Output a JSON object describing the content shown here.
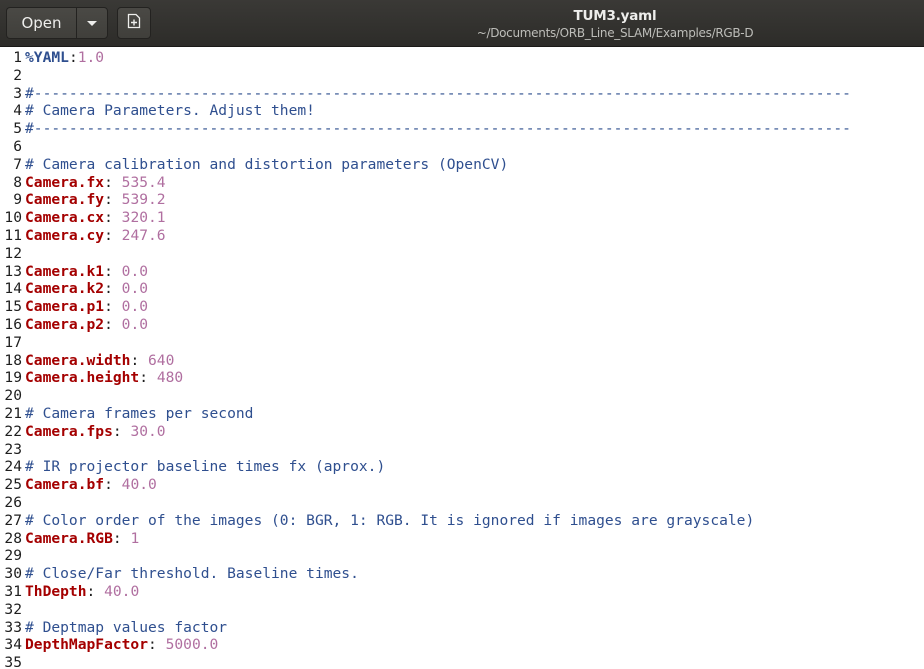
{
  "header": {
    "open_label": "Open",
    "title": "TUM3.yaml",
    "path": "~/Documents/ORB_Line_SLAM/Examples/RGB-D"
  },
  "icons": {
    "open_menu": "chevron-down-icon",
    "new_tab": "new-document-icon"
  },
  "colors": {
    "comment": "#2f4f8f",
    "key": "#a40000",
    "value": "#b06fa0",
    "header_bg": "#2d2c29"
  },
  "editor": {
    "lines": [
      {
        "num": "1",
        "type": "directive",
        "directive": "%YAML",
        "sep": ":",
        "value": "1.0"
      },
      {
        "num": "2",
        "type": "blank"
      },
      {
        "num": "3",
        "type": "comment",
        "text": "#---------------------------------------------------------------------------------------------"
      },
      {
        "num": "4",
        "type": "comment",
        "text": "# Camera Parameters. Adjust them!"
      },
      {
        "num": "5",
        "type": "comment",
        "text": "#---------------------------------------------------------------------------------------------"
      },
      {
        "num": "6",
        "type": "blank"
      },
      {
        "num": "7",
        "type": "comment",
        "text": "# Camera calibration and distortion parameters (OpenCV)"
      },
      {
        "num": "8",
        "type": "kv",
        "key": "Camera.fx",
        "value": "535.4"
      },
      {
        "num": "9",
        "type": "kv",
        "key": "Camera.fy",
        "value": "539.2"
      },
      {
        "num": "10",
        "type": "kv",
        "key": "Camera.cx",
        "value": "320.1"
      },
      {
        "num": "11",
        "type": "kv",
        "key": "Camera.cy",
        "value": "247.6"
      },
      {
        "num": "12",
        "type": "blank"
      },
      {
        "num": "13",
        "type": "kv",
        "key": "Camera.k1",
        "value": "0.0"
      },
      {
        "num": "14",
        "type": "kv",
        "key": "Camera.k2",
        "value": "0.0"
      },
      {
        "num": "15",
        "type": "kv",
        "key": "Camera.p1",
        "value": "0.0"
      },
      {
        "num": "16",
        "type": "kv",
        "key": "Camera.p2",
        "value": "0.0"
      },
      {
        "num": "17",
        "type": "blank"
      },
      {
        "num": "18",
        "type": "kv",
        "key": "Camera.width",
        "value": "640"
      },
      {
        "num": "19",
        "type": "kv",
        "key": "Camera.height",
        "value": "480"
      },
      {
        "num": "20",
        "type": "blank"
      },
      {
        "num": "21",
        "type": "comment",
        "text": "# Camera frames per second"
      },
      {
        "num": "22",
        "type": "kv",
        "key": "Camera.fps",
        "value": "30.0"
      },
      {
        "num": "23",
        "type": "blank"
      },
      {
        "num": "24",
        "type": "comment",
        "text": "# IR projector baseline times fx (aprox.)"
      },
      {
        "num": "25",
        "type": "kv",
        "key": "Camera.bf",
        "value": "40.0"
      },
      {
        "num": "26",
        "type": "blank"
      },
      {
        "num": "27",
        "type": "comment",
        "text": "# Color order of the images (0: BGR, 1: RGB. It is ignored if images are grayscale)"
      },
      {
        "num": "28",
        "type": "kv",
        "key": "Camera.RGB",
        "value": "1"
      },
      {
        "num": "29",
        "type": "blank"
      },
      {
        "num": "30",
        "type": "comment",
        "text": "# Close/Far threshold. Baseline times."
      },
      {
        "num": "31",
        "type": "kv",
        "key": "ThDepth",
        "value": "40.0"
      },
      {
        "num": "32",
        "type": "blank"
      },
      {
        "num": "33",
        "type": "comment",
        "text": "# Deptmap values factor"
      },
      {
        "num": "34",
        "type": "kv",
        "key": "DepthMapFactor",
        "value": "5000.0"
      },
      {
        "num": "35",
        "type": "blank"
      }
    ]
  }
}
